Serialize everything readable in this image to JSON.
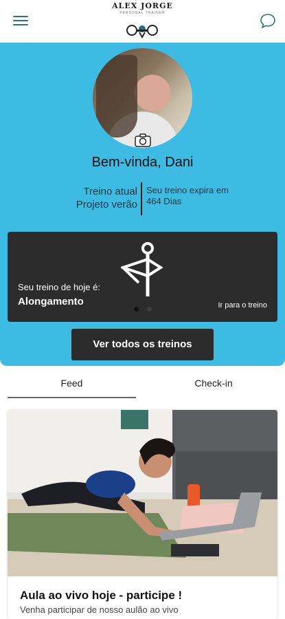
{
  "header": {
    "brand_name": "ALEX JORGE",
    "brand_subtitle": "PERSONAL TRAINER"
  },
  "profile": {
    "welcome": "Bem-vinda, Dani",
    "plan_label": "Treino atual",
    "plan_name": "Projeto verão",
    "expires_label": "Seu treino expira em",
    "expires_value": "464 Dias"
  },
  "today": {
    "label": "Seu treino de hoje é:",
    "name": "Alongamento",
    "goto_label": "Ir para o treino"
  },
  "actions": {
    "all_workouts": "Ver todos os treinos"
  },
  "tabs": [
    {
      "label": "Feed",
      "selected": true
    },
    {
      "label": "Check-in",
      "selected": false
    }
  ],
  "feed": {
    "title": "Aula ao vivo hoje - participe !",
    "description": "Venha participar de nosso aulão ao vivo"
  },
  "colors": {
    "accent": "#3ebbe2",
    "card_dark": "#2c2c2c"
  }
}
